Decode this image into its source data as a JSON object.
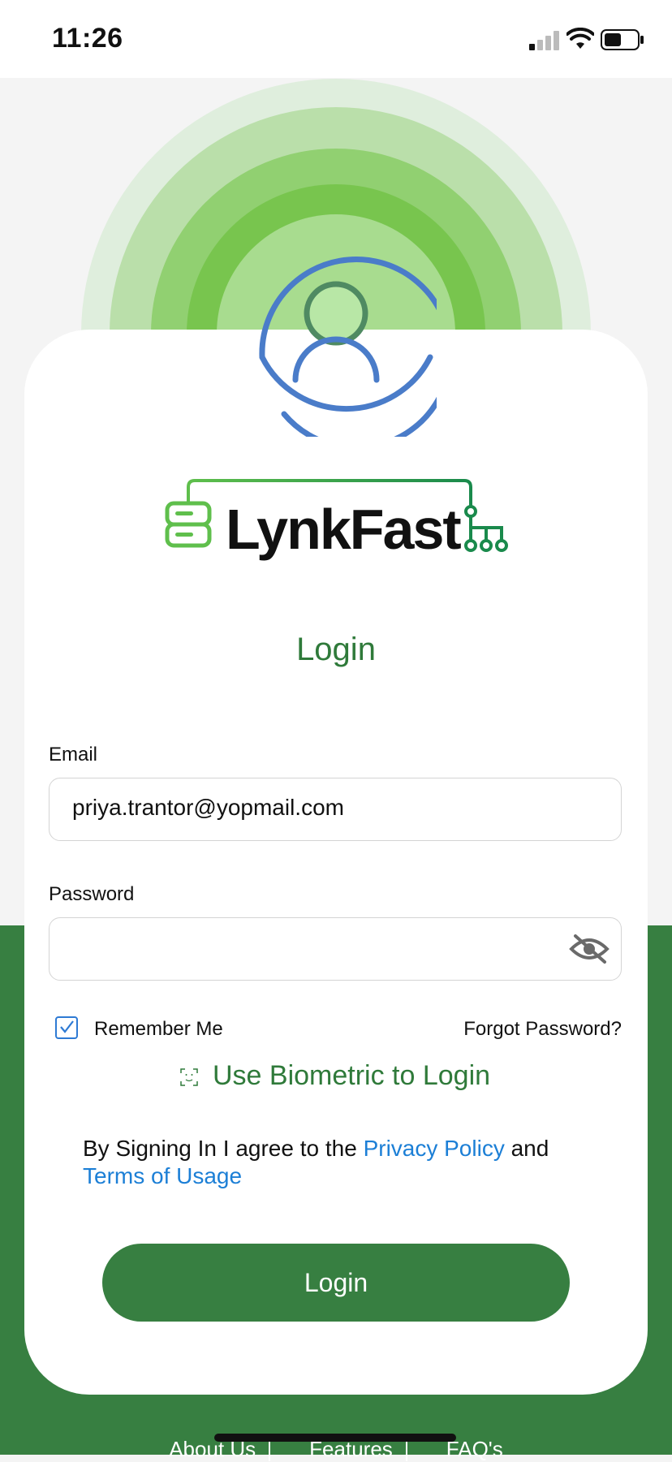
{
  "status_bar": {
    "time": "11:26"
  },
  "brand": {
    "name": "LynkFast"
  },
  "login": {
    "title": "Login",
    "email_label": "Email",
    "email_value": "priya.trantor@yopmail.com",
    "password_label": "Password",
    "password_value": "",
    "remember_me_label": "Remember Me",
    "remember_me_checked": true,
    "forgot_password": "Forgot Password?",
    "biometric_label": "Use Biometric to Login",
    "agreement": {
      "prefix": "By Signing In I agree to the ",
      "privacy_link": "Privacy Policy",
      "middle": " and",
      "terms_link": "Terms of Usage"
    },
    "login_button": "Login"
  },
  "footer": {
    "links": [
      "About Us",
      "Features",
      "FAQ's"
    ]
  },
  "colors": {
    "brand_green": "#377f41",
    "title_green": "#2f7a3a",
    "link_blue": "#1c7fd6",
    "avatar_blue": "#4a7cc9"
  },
  "icons": [
    "avatar-icon",
    "eye-off-icon",
    "checkbox-check-icon",
    "face-id-icon",
    "signal-icon",
    "wifi-icon",
    "battery-icon",
    "server-logo-icon",
    "network-logo-icon"
  ]
}
